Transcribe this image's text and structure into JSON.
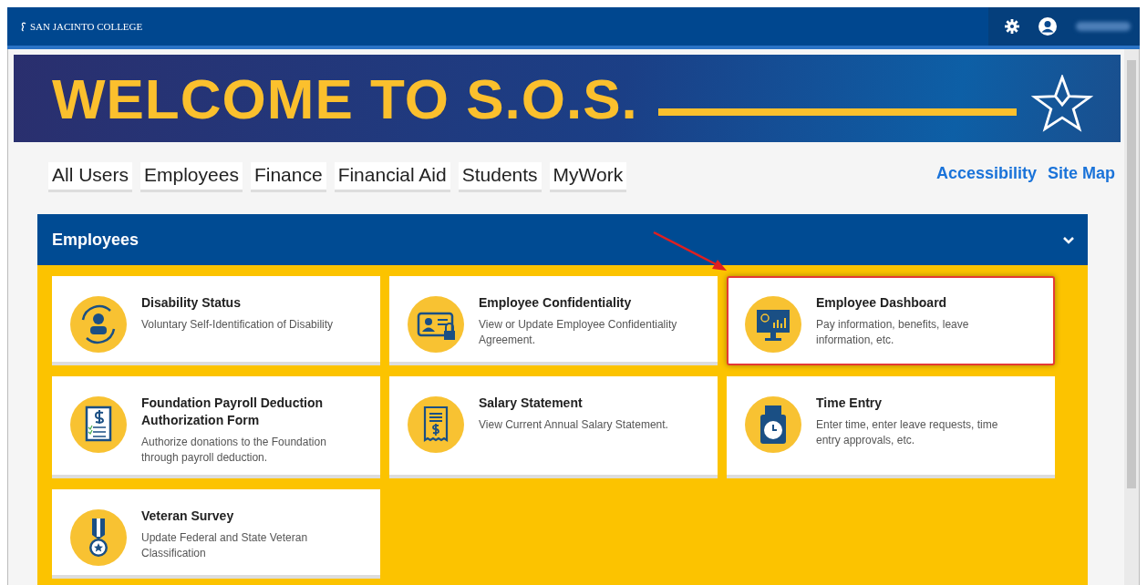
{
  "top_bar": {
    "logo": "SAN JACINTO COLLEGE"
  },
  "banner": {
    "title": "WELCOME TO S.O.S."
  },
  "tabs": [
    {
      "label": "All Users",
      "selected": false
    },
    {
      "label": "Employees",
      "selected": false
    },
    {
      "label": "Finance",
      "selected": false
    },
    {
      "label": "Financial Aid",
      "selected": false
    },
    {
      "label": "Students",
      "selected": false
    },
    {
      "label": "MyWork",
      "selected": false
    }
  ],
  "links": [
    "Accessibility",
    "Site Map"
  ],
  "panel": {
    "title": "Employees",
    "expanded": true,
    "cards": [
      {
        "title": "Disability Status",
        "description": "Voluntary Self-Identification of Disability",
        "highlighted": false
      },
      {
        "title": "Employee Confidentiality",
        "description": "View or Update Employee Confidentiality Agreement.",
        "highlighted": false
      },
      {
        "title": "Employee Dashboard",
        "description": "Pay information, benefits, leave information, etc.",
        "highlighted": true
      },
      {
        "title": "Foundation Payroll Deduction Authorization Form",
        "description": "Authorize donations to the Foundation through payroll deduction.",
        "highlighted": false
      },
      {
        "title": "Salary Statement",
        "description": "View Current Annual Salary Statement.",
        "highlighted": false
      },
      {
        "title": "Time Entry",
        "description": "Enter time, enter leave requests, time entry approvals, etc.",
        "highlighted": false
      },
      {
        "title": "Veteran Survey",
        "description": "Update Federal and State Veteran Classification",
        "highlighted": false
      }
    ]
  }
}
